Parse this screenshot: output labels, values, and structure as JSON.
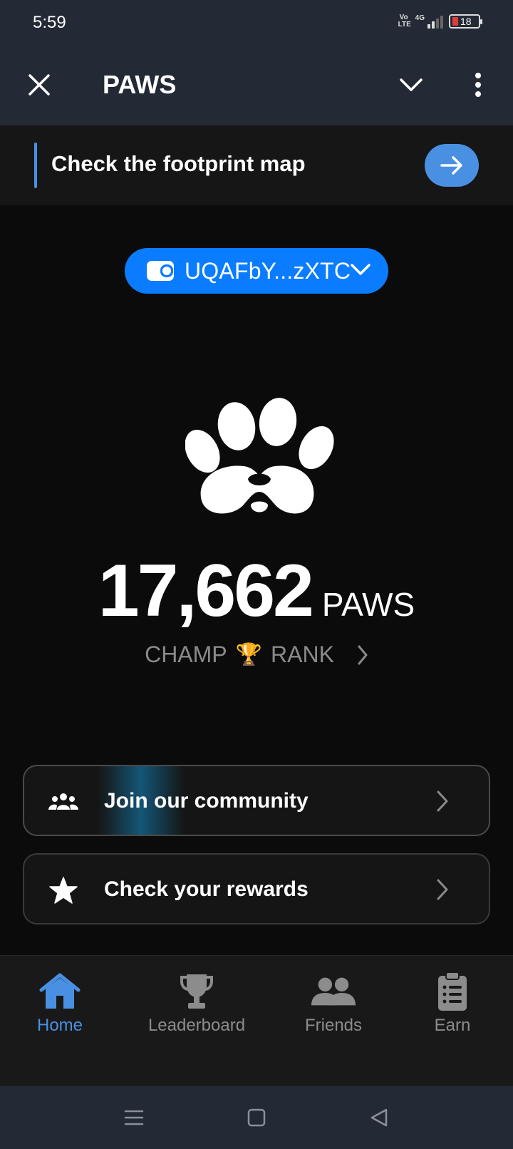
{
  "status_bar": {
    "time": "5:59",
    "volte_line1": "Vo",
    "volte_line2": "LTE",
    "network": "4G",
    "battery": "18"
  },
  "header": {
    "title": "PAWS"
  },
  "banner": {
    "text": "Check the footprint map"
  },
  "wallet": {
    "address": "UQAFbY...zXTC"
  },
  "balance": {
    "value": "17,662",
    "unit": "PAWS",
    "rank_left": "CHAMP",
    "rank_emoji": "🏆",
    "rank_right": "RANK"
  },
  "cards": [
    {
      "label": "Join our community",
      "icon": "community-icon"
    },
    {
      "label": "Check your rewards",
      "icon": "star-icon"
    }
  ],
  "nav": {
    "items": [
      {
        "label": "Home",
        "icon": "home-icon",
        "active": true
      },
      {
        "label": "Leaderboard",
        "icon": "trophy-icon",
        "active": false
      },
      {
        "label": "Friends",
        "icon": "friends-icon",
        "active": false
      },
      {
        "label": "Earn",
        "icon": "clipboard-icon",
        "active": false
      }
    ]
  },
  "colors": {
    "accent": "#4a90e2",
    "wallet": "#0a7cff",
    "background": "#0b0b0b",
    "header": "#232a36"
  }
}
